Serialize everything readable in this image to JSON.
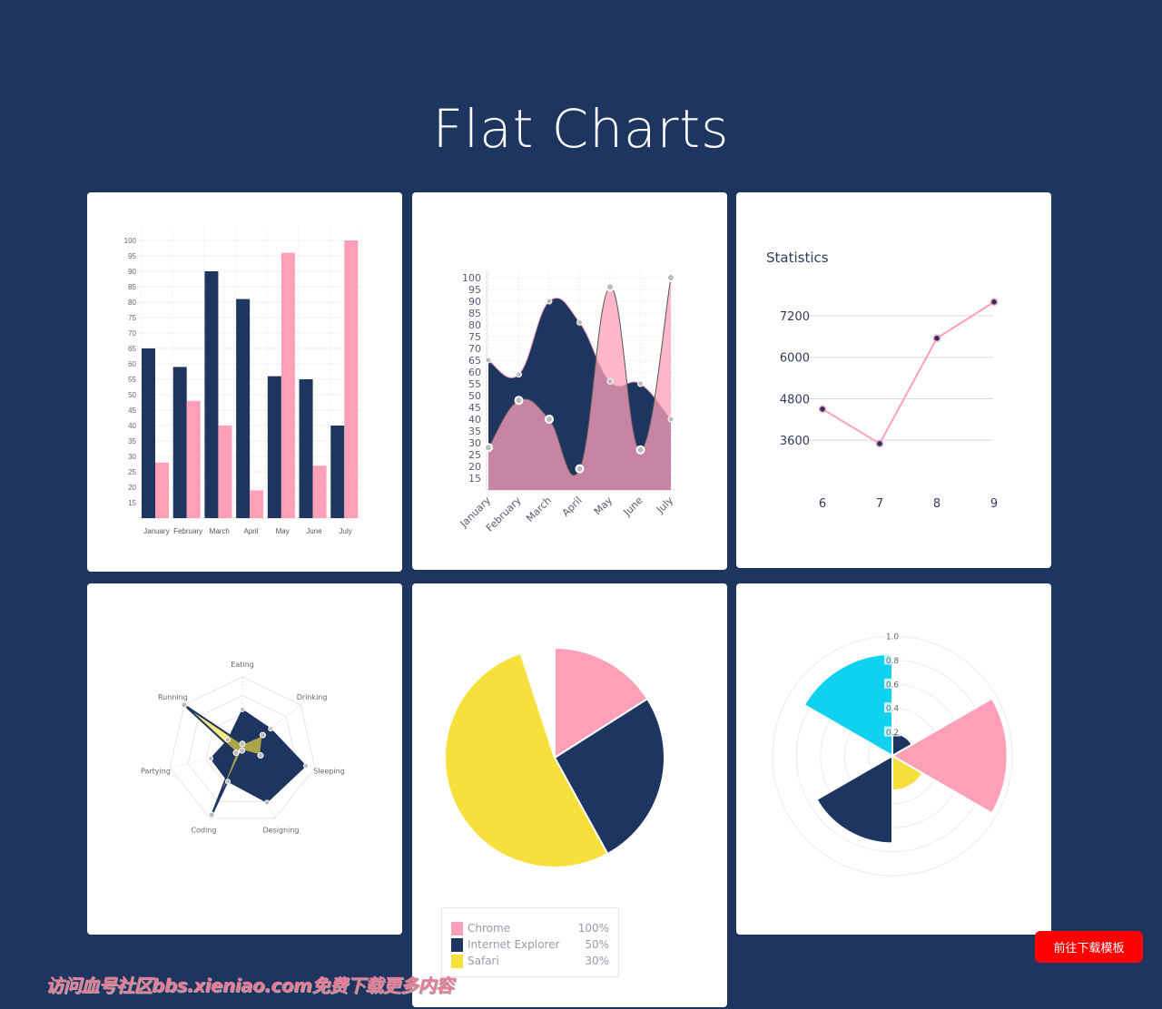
{
  "page": {
    "title": "Flat Charts",
    "download_button": "前往下载模板",
    "watermark": "访问血号社区bbs.xieniao.com免费下载更多内容"
  },
  "colors": {
    "background": "#1e3560",
    "navy": "#1e3560",
    "pink": "#ffa0b8",
    "yellow": "#f7e03c",
    "cyan": "#10d2f0",
    "red": "#c0506a",
    "grid": "#ececec"
  },
  "chart_data": [
    {
      "type": "bar",
      "categories": [
        "January",
        "February",
        "March",
        "April",
        "May",
        "June",
        "July"
      ],
      "series": [
        {
          "values": [
            65,
            59,
            90,
            81,
            56,
            55,
            40
          ],
          "color": "#1e3560"
        },
        {
          "values": [
            28,
            48,
            40,
            19,
            96,
            27,
            100
          ],
          "color": "#ffa0b8"
        }
      ],
      "ylim": [
        10,
        100
      ],
      "yticks": [
        15,
        20,
        25,
        30,
        35,
        40,
        45,
        50,
        55,
        60,
        65,
        70,
        75,
        80,
        85,
        90,
        95,
        100
      ],
      "grid": true
    },
    {
      "type": "area",
      "categories": [
        "January",
        "February",
        "March",
        "April",
        "May",
        "June",
        "July"
      ],
      "series": [
        {
          "values": [
            65,
            59,
            90,
            81,
            56,
            55,
            40
          ],
          "color": "#1e3560"
        },
        {
          "values": [
            28,
            48,
            40,
            19,
            96,
            27,
            100
          ],
          "color": "#ffa0b8"
        }
      ],
      "ylim": [
        10,
        100
      ],
      "yticks": [
        15,
        20,
        25,
        30,
        35,
        40,
        45,
        50,
        55,
        60,
        65,
        70,
        75,
        80,
        85,
        90,
        95,
        100
      ],
      "grid": true,
      "smooth": true
    },
    {
      "type": "line",
      "title": "Statistics",
      "x": [
        "6",
        "7",
        "8",
        "9"
      ],
      "series": [
        {
          "values": [
            4500,
            3500,
            6550,
            7600
          ],
          "color": "#ffa0b8",
          "marker_color": "#1e3560"
        }
      ],
      "yticks": [
        3600,
        4800,
        6000,
        7200
      ],
      "grid": true
    },
    {
      "type": "radar",
      "labels": [
        "Eating",
        "Drinking",
        "Sleeping",
        "Designing",
        "Coding",
        "Partying",
        "Running"
      ],
      "series": [
        {
          "values": [
            65,
            59,
            90,
            81,
            56,
            55,
            40
          ],
          "color": "#1e3560"
        },
        {
          "values": [
            28,
            48,
            40,
            19,
            96,
            27,
            100
          ],
          "color": "#f7e03c"
        }
      ],
      "range": [
        20,
        100
      ]
    },
    {
      "type": "pie",
      "slices": [
        {
          "label": "Chrome",
          "value": 16,
          "color": "#ffa0b8"
        },
        {
          "label": "Internet Explorer",
          "value": 26,
          "color": "#1e3560"
        },
        {
          "label": "Safari",
          "value": 53,
          "color": "#f7e03c"
        },
        {
          "value": 5,
          "color": "#ffffff"
        }
      ],
      "legend": [
        {
          "label": "Chrome",
          "value": "100%",
          "color": "#ffa0b8"
        },
        {
          "label": "Internet Explorer",
          "value": "50%",
          "color": "#1e3560"
        },
        {
          "label": "Safari",
          "value": "30%",
          "color": "#f7e03c"
        }
      ],
      "legend_placement": "bottom"
    },
    {
      "type": "polarArea",
      "values": [
        0.19,
        0.96,
        0.29,
        0.73,
        0.03,
        0.85
      ],
      "colors": [
        "#1e3560",
        "#ffa0b8",
        "#f7e03c",
        "#1e3560",
        "#c0506a",
        "#10d2f0"
      ],
      "rticks": [
        "0.2",
        "0.4",
        "0.6",
        "0.8",
        "1.0"
      ],
      "rlim": [
        0,
        1.0
      ]
    }
  ]
}
